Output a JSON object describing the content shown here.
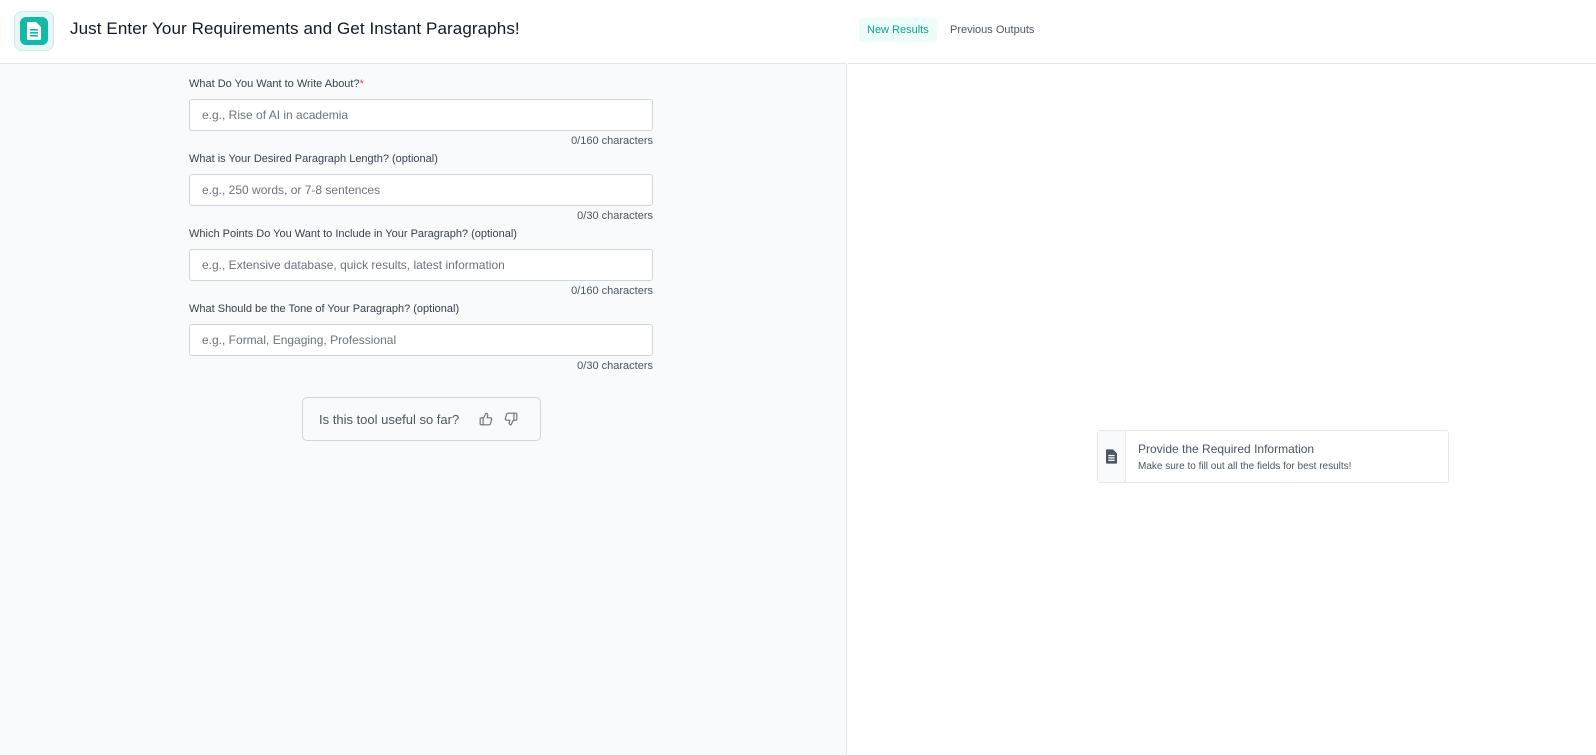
{
  "header": {
    "title": "Just Enter Your Requirements and Get Instant Paragraphs!",
    "logo_icon": "document-icon",
    "accent_color": "#14b8a6"
  },
  "tabs": {
    "new_results": "New Results",
    "previous_outputs": "Previous Outputs"
  },
  "form": {
    "fields": [
      {
        "label": "What Do You Want to Write About?",
        "required_mark": "*",
        "placeholder": "e.g., Rise of AI in academia",
        "value": "",
        "count": "0/160 characters"
      },
      {
        "label": "What is Your Desired Paragraph Length? (optional)",
        "placeholder": "e.g., 250 words, or 7-8 sentences",
        "value": "",
        "count": "0/30 characters"
      },
      {
        "label": "Which Points Do You Want to Include in Your Paragraph? (optional)",
        "placeholder": "e.g., Extensive database, quick results, latest information",
        "value": "",
        "count": "0/160 characters"
      },
      {
        "label": "What Should be the Tone of Your Paragraph? (optional)",
        "placeholder": "e.g., Formal, Engaging, Professional",
        "value": "",
        "count": "0/30 characters"
      }
    ]
  },
  "feedback": {
    "question": "Is this tool useful so far?",
    "up_icon": "thumbs-up-icon",
    "down_icon": "thumbs-down-icon"
  },
  "results": {
    "title": "Provide the Required Information",
    "subtitle": "Make sure to fill out all the fields for best results!",
    "icon": "document-icon"
  }
}
